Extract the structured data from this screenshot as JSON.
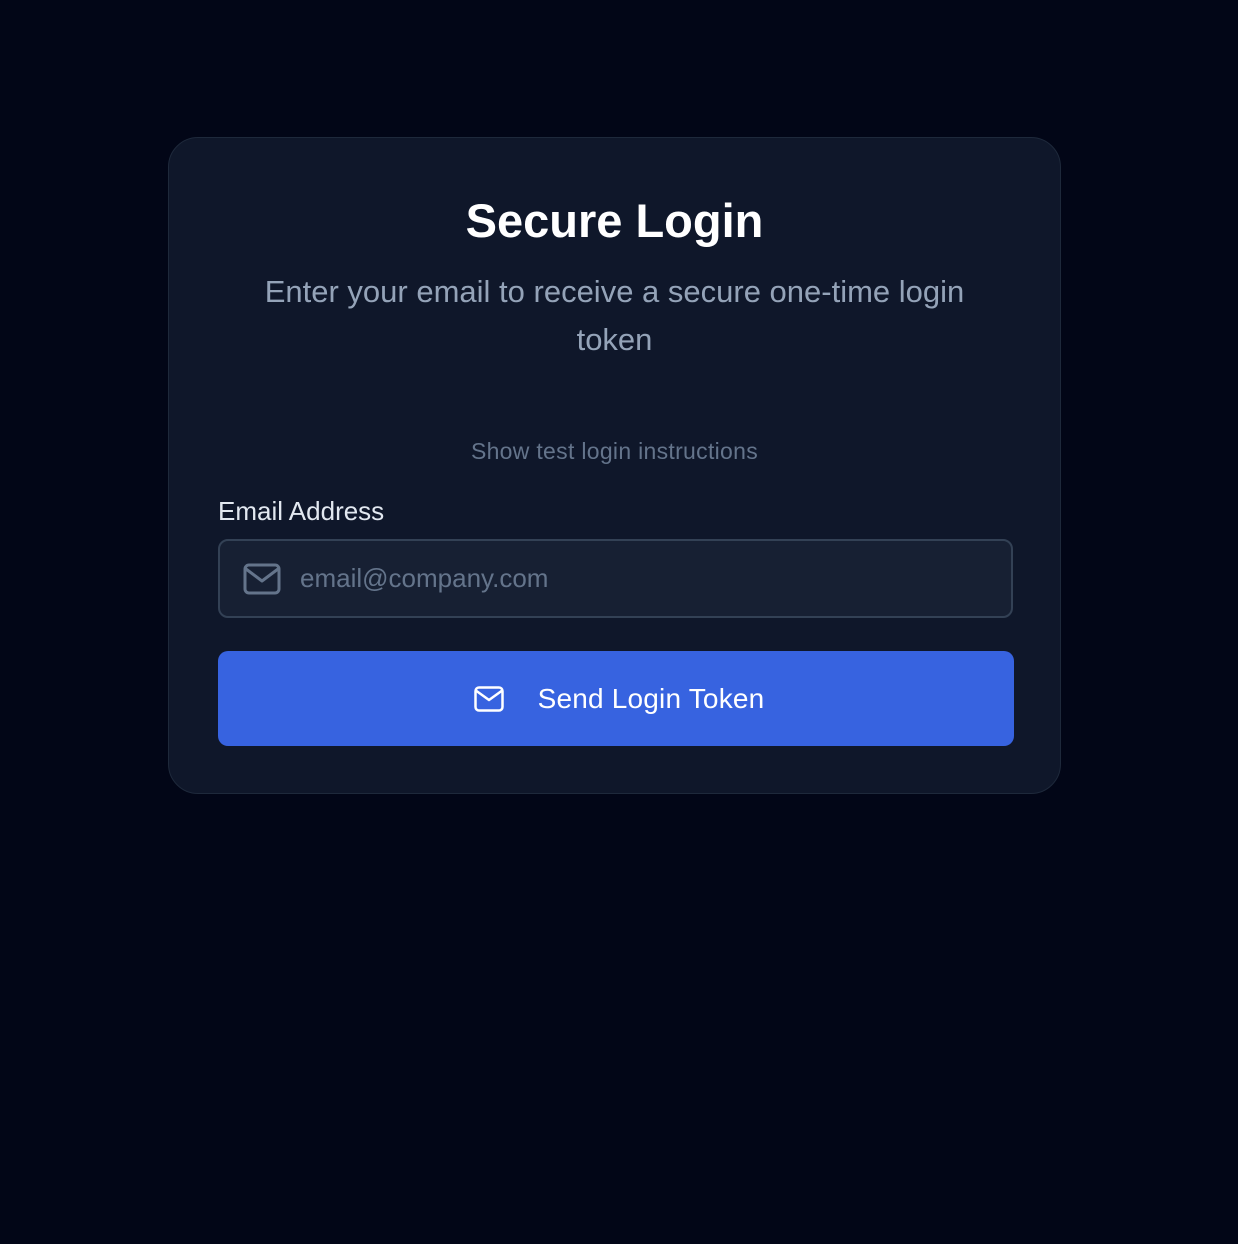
{
  "login": {
    "title": "Secure Login",
    "subtitle": "Enter your email to receive a secure one-time login token",
    "instructions_link": "Show test login instructions",
    "email_label": "Email Address",
    "email_placeholder": "email@company.com",
    "email_value": "",
    "send_button_label": "Send Login Token",
    "input_icon": "mail-icon",
    "button_icon": "mail-icon"
  },
  "colors": {
    "background": "#020617",
    "card": "#0f172a",
    "accent": "#3763e0",
    "muted_text": "#94a3b8"
  }
}
